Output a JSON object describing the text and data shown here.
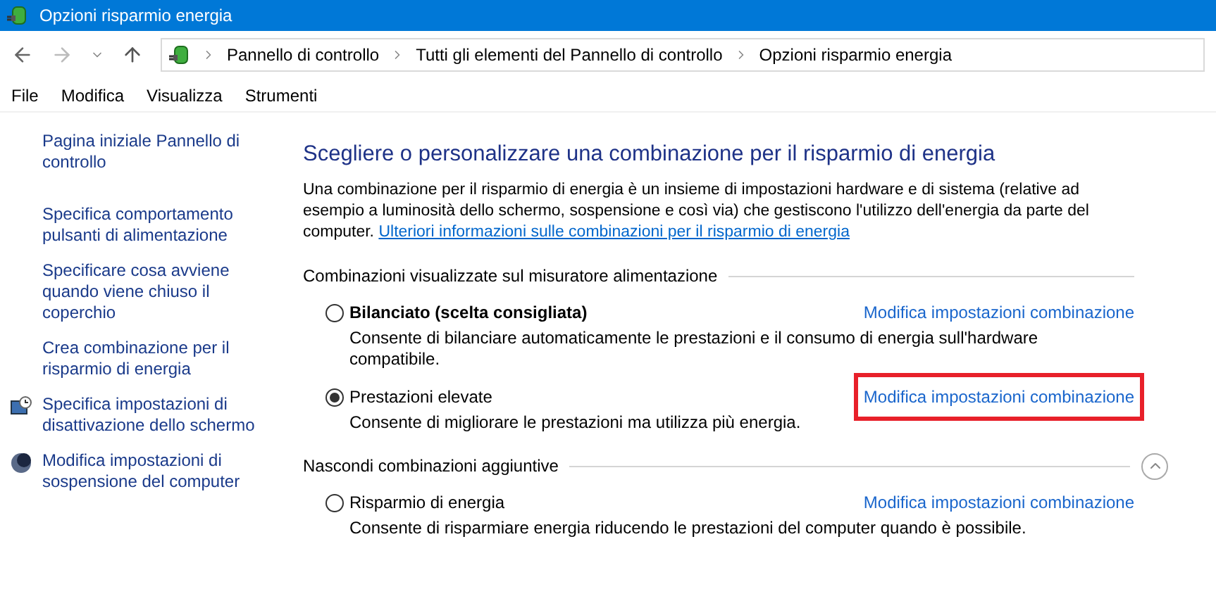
{
  "window": {
    "title": "Opzioni risparmio energia"
  },
  "breadcrumb": [
    "Pannello di controllo",
    "Tutti gli elementi del Pannello di controllo",
    "Opzioni risparmio energia"
  ],
  "menu": [
    "File",
    "Modifica",
    "Visualizza",
    "Strumenti"
  ],
  "sidebar": {
    "items": [
      {
        "label": "Pagina iniziale Pannello di controllo",
        "kind": "plain"
      },
      {
        "label": "Specifica comportamento pulsanti di alimentazione",
        "kind": "plain"
      },
      {
        "label": "Specificare cosa avviene quando viene chiuso il coperchio",
        "kind": "plain"
      },
      {
        "label": "Crea combinazione per il risparmio di energia",
        "kind": "plain"
      },
      {
        "label": "Specifica impostazioni di disattivazione dello schermo",
        "kind": "display"
      },
      {
        "label": "Modifica impostazioni di sospensione del computer",
        "kind": "sleep"
      }
    ]
  },
  "heading": "Scegliere o personalizzare una combinazione per il risparmio di energia",
  "intro": "Una combinazione per il risparmio di energia è un insieme di impostazioni hardware e di sistema (relative ad esempio a luminosità dello schermo, sospensione e così via) che gestiscono l'utilizzo dell'energia da parte del computer.",
  "intro_link": "Ulteriori informazioni sulle combinazioni per il risparmio di energia",
  "groups": [
    {
      "label": "Combinazioni visualizzate sul misuratore alimentazione",
      "plans": [
        {
          "name": "Bilanciato (scelta consigliata)",
          "recommended": true,
          "selected": false,
          "description": "Consente di bilanciare automaticamente le prestazioni e il consumo di energia sull'hardware compatibile.",
          "link": "Modifica impostazioni combinazione",
          "highlighted": false
        },
        {
          "name": "Prestazioni elevate",
          "recommended": false,
          "selected": true,
          "description": "Consente di migliorare le prestazioni ma utilizza più energia.",
          "link": "Modifica impostazioni combinazione",
          "highlighted": true
        }
      ]
    },
    {
      "label": "Nascondi combinazioni aggiuntive",
      "expanded": true,
      "plans": [
        {
          "name": "Risparmio di energia",
          "recommended": false,
          "selected": false,
          "description": "Consente di risparmiare energia riducendo le prestazioni del computer quando è possibile.",
          "link": "Modifica impostazioni combinazione",
          "highlighted": false
        }
      ]
    }
  ]
}
